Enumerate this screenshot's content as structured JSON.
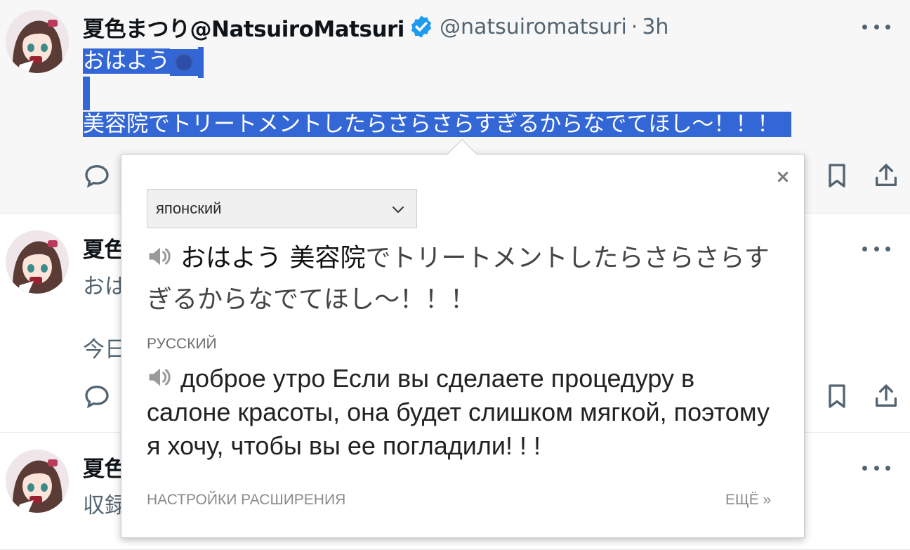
{
  "tweets": [
    {
      "display_name": "夏色まつり@NatsuiroMatsuri",
      "handle": "@natsuiromatsuri",
      "separator": "·",
      "time": "3h",
      "line1": "おはよう",
      "line3": "美容院でトリートメントしたらさらさらすぎるからなでてほし〜！！！"
    },
    {
      "display_name_visible": "夏色",
      "text_visible": "おは",
      "text2_visible": "今日"
    },
    {
      "display_name_visible": "夏色",
      "text_visible": "収録"
    }
  ],
  "icons": {
    "more": "more-horizontal-icon",
    "verified": "verified-badge-icon",
    "reply": "reply-icon",
    "bookmark": "bookmark-icon",
    "share": "share-icon",
    "sun_emoji": "sun-emoji-icon",
    "speaker": "speaker-icon",
    "close": "close-icon",
    "chevron": "chevron-down-icon"
  },
  "colors": {
    "selection": "#3367d6",
    "verified": "#1d9bf0",
    "secondary_text": "#536471"
  },
  "popup": {
    "source_language": "японский",
    "source_text_highlight": "おはよう 美容院",
    "source_text_rest": "でトリートメントしたらさらさらすぎるからなでてほし〜！！！",
    "target_language": "РУССКИЙ",
    "target_text": "доброе утро Если вы сделаете процедуру в салоне красоты, она будет слишком мягкой, поэтому я хочу, чтобы вы ее погладили! ! !",
    "close_label": "×",
    "settings_link": "НАСТРОЙКИ РАСШИРЕНИЯ",
    "more_link": "ЕЩЁ »"
  }
}
